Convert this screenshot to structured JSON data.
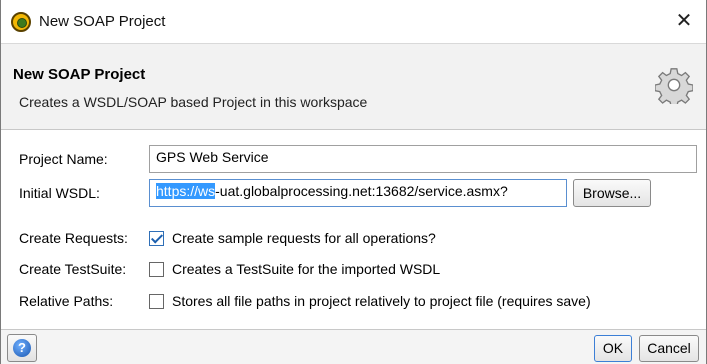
{
  "window": {
    "title": "New SOAP Project",
    "close_symbol": "✕",
    "icon": "soapui-app-icon"
  },
  "header": {
    "title": "New SOAP Project",
    "description": "Creates a WSDL/SOAP based Project in this workspace",
    "icon": "gear-icon"
  },
  "form": {
    "project_name": {
      "label": "Project Name:",
      "value": "GPS Web Service"
    },
    "initial_wsdl": {
      "label": "Initial WSDL:",
      "value_selected": "https://ws",
      "value_rest": "-uat.globalprocessing.net:13682/service.asmx?",
      "browse_label": "Browse..."
    },
    "create_requests": {
      "label": "Create Requests:",
      "checked": true,
      "text": "Create sample requests for all operations?"
    },
    "create_testsuite": {
      "label": "Create TestSuite:",
      "checked": false,
      "text": "Creates a TestSuite for the imported WSDL"
    },
    "relative_paths": {
      "label": "Relative Paths:",
      "checked": false,
      "text": "Stores all file paths in project relatively to project file (requires save)"
    }
  },
  "footer": {
    "help_icon": "help-icon",
    "ok_label": "OK",
    "cancel_label": "Cancel"
  },
  "colors": {
    "selection": "#3399ff",
    "header_bg": "#f2f2f2",
    "focus_border": "#5a8fd0"
  }
}
